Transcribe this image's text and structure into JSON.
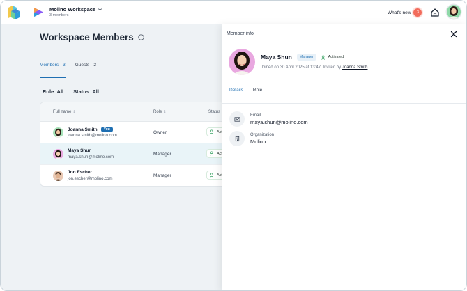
{
  "topbar": {
    "workspace_name": "Molino Workspace",
    "workspace_sub": "3 members",
    "whats_new": "What's new",
    "notif_count": "3"
  },
  "page": {
    "title": "Workspace Members",
    "tabs": [
      {
        "label": "Members",
        "count": "3"
      },
      {
        "label": "Guests",
        "count": "2"
      }
    ],
    "filters": {
      "role": "Role: All",
      "status": "Status: All"
    }
  },
  "table": {
    "headers": {
      "name": "Full name",
      "role": "Role",
      "status": "Status"
    },
    "rows": [
      {
        "name": "Joanna Smith",
        "email": "joanna.smith@molino.com",
        "role": "Owner",
        "status": "Acti",
        "you": "You"
      },
      {
        "name": "Maya Shun",
        "email": "maya.shun@molino.com",
        "role": "Manager",
        "status": "Acti"
      },
      {
        "name": "Jon Escher",
        "email": "jon.escher@molino.com",
        "role": "Manager",
        "status": "Acti"
      }
    ]
  },
  "drawer": {
    "title": "Member info",
    "name": "Maya Shun",
    "role_badge": "Manager",
    "status": "Activated",
    "joined": "Joined on 30 April 2025 at 13:47. Invited by",
    "invited_by": "Joanna Smith",
    "tabs": [
      "Details",
      "Role"
    ],
    "fields": [
      {
        "label": "Email",
        "value": "maya.shun@molino.com",
        "icon": "mail-icon"
      },
      {
        "label": "Organization",
        "value": "Molino",
        "icon": "building-icon"
      }
    ]
  },
  "colors": {
    "accent": "#1f6fb2",
    "notif": "#f26b5b",
    "activated": "#2f9e5b"
  }
}
